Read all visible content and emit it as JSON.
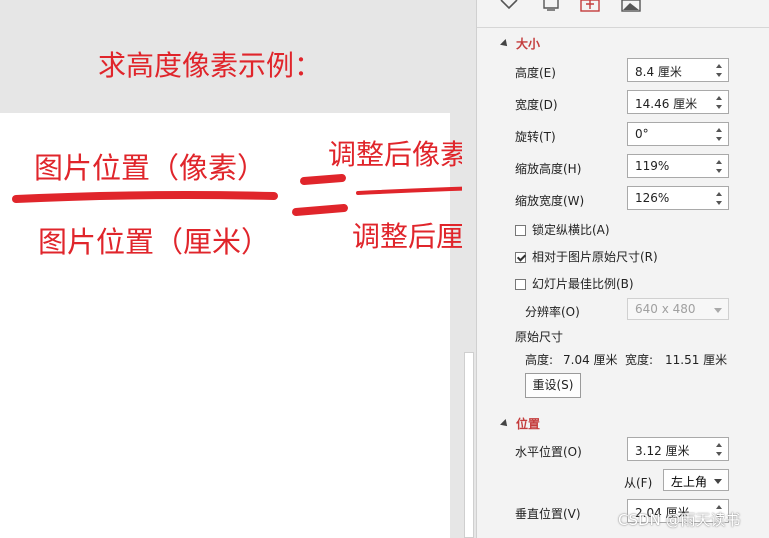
{
  "annotations": {
    "title": "求高度像素示例：",
    "image_pos_px": "图片位置（像素）",
    "image_pos_cm": "图片位置（厘米）",
    "adjusted_px": "调整后像素 X",
    "adjusted_cm": "调整后厘米",
    "color": "#e0252b"
  },
  "panel": {
    "tab_icons": [
      "fill-line-icon",
      "effects-icon",
      "size-properties-icon",
      "picture-icon"
    ],
    "accent": "#c43c3c",
    "size_section": {
      "title": "大小",
      "height": {
        "label": "高度(E)",
        "value": "8.4 厘米"
      },
      "width": {
        "label": "宽度(D)",
        "value": "14.46 厘米"
      },
      "rotation": {
        "label": "旋转(T)",
        "value": "0°"
      },
      "scale_height": {
        "label": "缩放高度(H)",
        "value": "119%"
      },
      "scale_width": {
        "label": "缩放宽度(W)",
        "value": "126%"
      },
      "lock_aspect": {
        "label": "锁定纵横比(A)",
        "checked": false
      },
      "relative_original": {
        "label": "相对于图片原始尺寸(R)",
        "checked": true
      },
      "best_scale": {
        "label": "幻灯片最佳比例(B)",
        "checked": false
      },
      "resolution": {
        "label": "分辨率(O)",
        "value": "640 x 480"
      },
      "original_size": {
        "title": "原始尺寸",
        "height_label": "高度:",
        "height_value": "7.04 厘米",
        "width_label": "宽度:",
        "width_value": "11.51 厘米"
      },
      "reset_label": "重设(S)"
    },
    "position_section": {
      "title": "位置",
      "horizontal": {
        "label": "水平位置(O)",
        "value": "3.12 厘米"
      },
      "from_h": {
        "label": "从(F)",
        "value": "左上角"
      },
      "vertical": {
        "label": "垂直位置(V)",
        "value": "2.04 厘米"
      }
    }
  },
  "watermark": "CSDN @雨天读书"
}
